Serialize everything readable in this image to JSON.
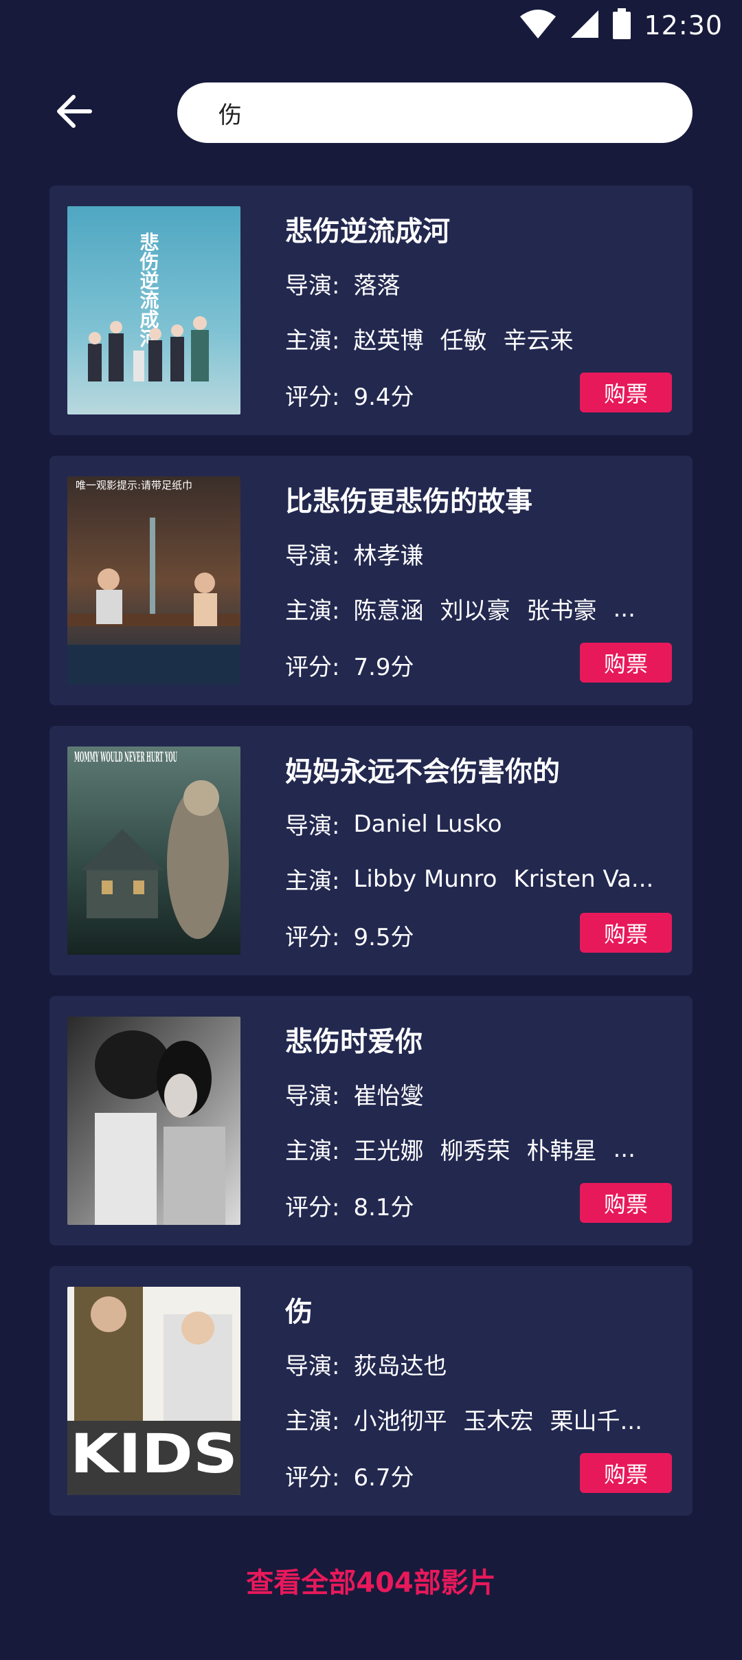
{
  "status_bar": {
    "time": "12:30",
    "icons": [
      "wifi-icon",
      "signal-icon",
      "battery-icon"
    ]
  },
  "header": {
    "back_icon": "arrow-left-icon",
    "search_value": "伤"
  },
  "labels": {
    "director": "导演:",
    "cast": "主演:",
    "rating": "评分:",
    "buy": "购票"
  },
  "movies": [
    {
      "title": "悲伤逆流成河",
      "director": "落落",
      "cast": [
        "赵英博",
        "任敏",
        "辛云来"
      ],
      "cast_more": "",
      "rating": "9.4分",
      "poster_text": "悲伤逆流成河"
    },
    {
      "title": "比悲伤更悲伤的故事",
      "director": "林孝谦",
      "cast": [
        "陈意涵",
        "刘以豪",
        "张书豪"
      ],
      "cast_more": "...",
      "rating": "7.9分",
      "poster_text": "唯一观影提示:请带足纸巾"
    },
    {
      "title": "妈妈永远不会伤害你的",
      "director": "Daniel Lusko",
      "cast": [
        "Libby Munro",
        "Kristen Va..."
      ],
      "cast_more": "",
      "rating": "9.5分",
      "poster_text": "MOMMY WOULD NEVER HURT YOU"
    },
    {
      "title": "悲伤时爱你",
      "director": "崔怡燮",
      "cast": [
        "王光娜",
        "柳秀荣",
        "朴韩星"
      ],
      "cast_more": "...",
      "rating": "8.1分",
      "poster_text": ""
    },
    {
      "title": "伤",
      "director": "荻岛达也",
      "cast": [
        "小池彻平",
        "玉木宏",
        "栗山千..."
      ],
      "cast_more": "",
      "rating": "6.7分",
      "poster_text": "KIDS"
    }
  ],
  "footer": {
    "view_all": "查看全部404部影片"
  },
  "colors": {
    "background": "#171a3b",
    "card": "#23284f",
    "accent": "#e8195b"
  }
}
